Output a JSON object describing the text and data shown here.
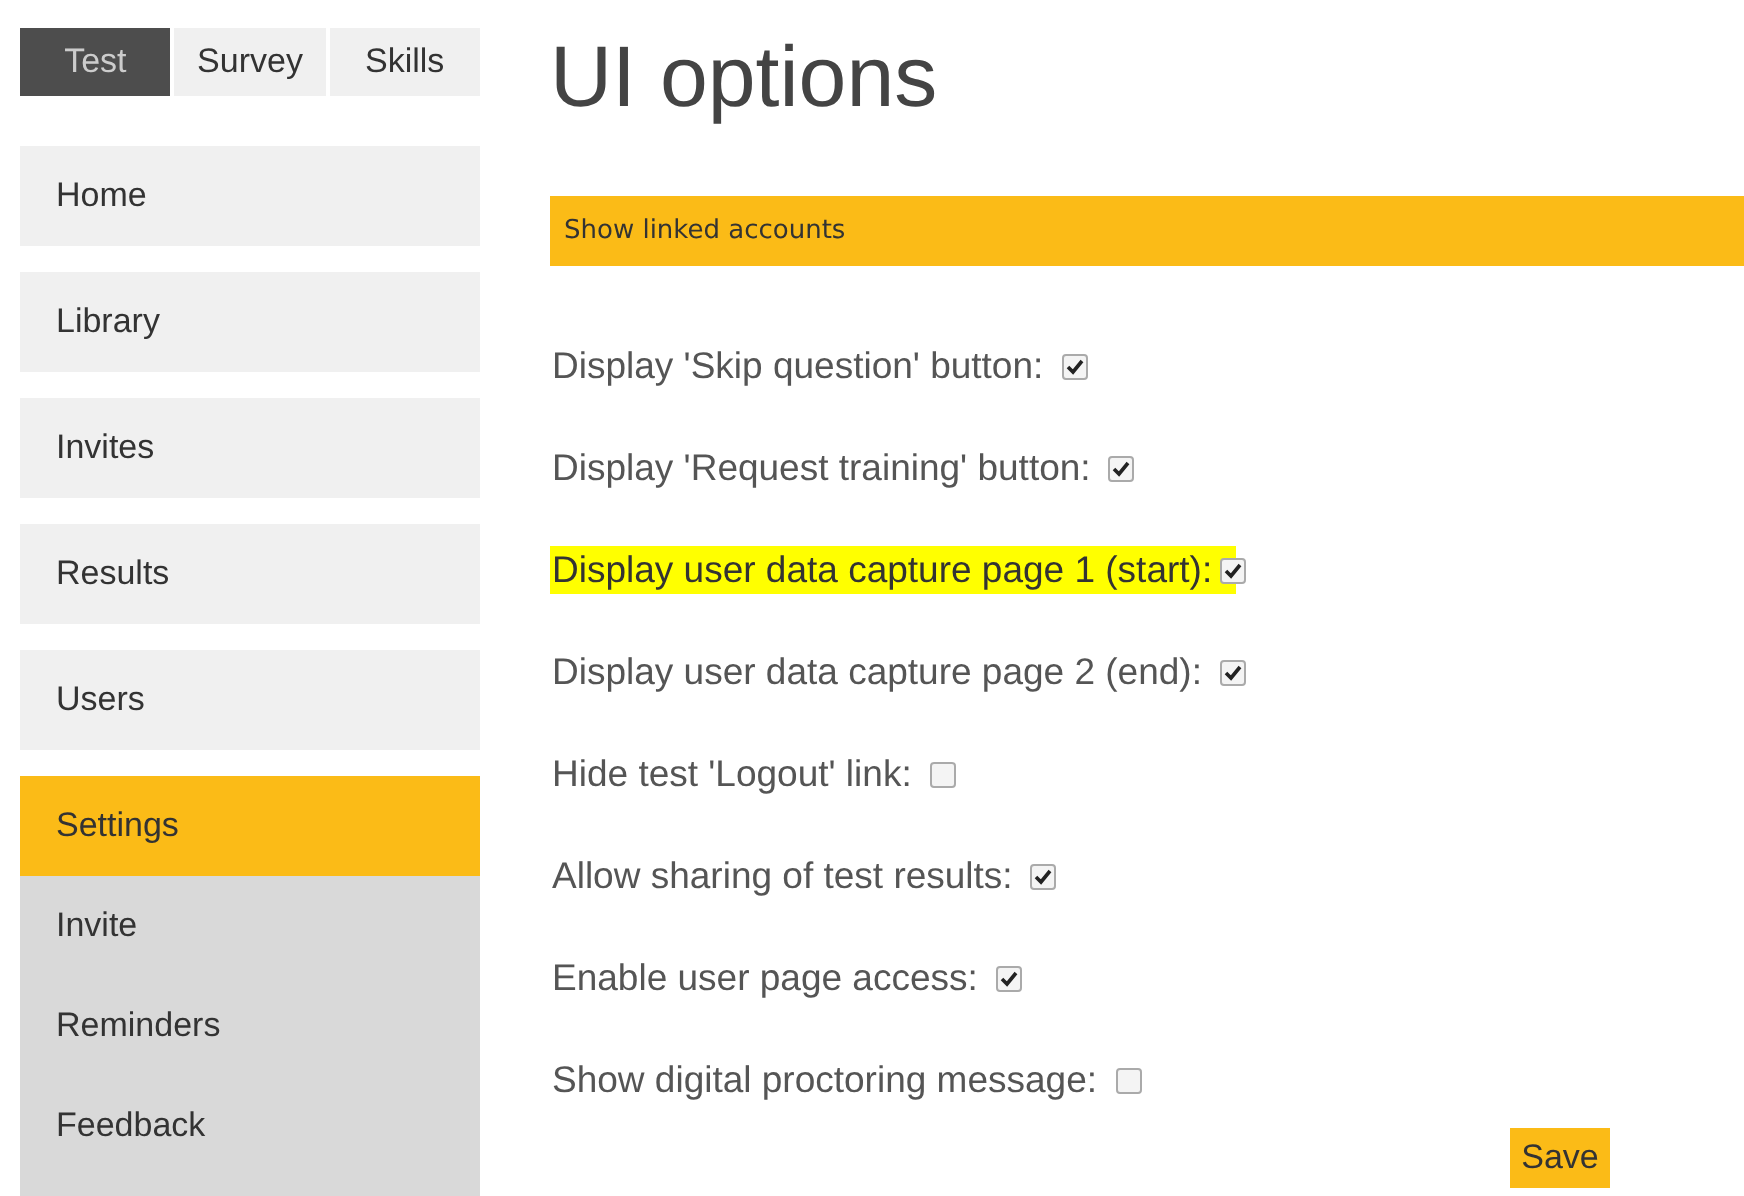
{
  "tabs": [
    {
      "label": "Test",
      "selected": true
    },
    {
      "label": "Survey",
      "selected": false
    },
    {
      "label": "Skills",
      "selected": false
    }
  ],
  "nav": [
    {
      "label": "Home",
      "selected": false
    },
    {
      "label": "Library",
      "selected": false
    },
    {
      "label": "Invites",
      "selected": false
    },
    {
      "label": "Results",
      "selected": false
    },
    {
      "label": "Users",
      "selected": false
    },
    {
      "label": "Settings",
      "selected": true,
      "children": [
        {
          "label": "Invite"
        },
        {
          "label": "Reminders"
        },
        {
          "label": "Feedback"
        }
      ]
    }
  ],
  "title": "UI options",
  "banner": "Show linked accounts",
  "options": [
    {
      "label": "Display 'Skip question' button:",
      "checked": true,
      "highlighted": false
    },
    {
      "label": "Display 'Request training' button:",
      "checked": true,
      "highlighted": false
    },
    {
      "label": "Display user data capture page 1 (start):",
      "checked": true,
      "highlighted": true
    },
    {
      "label": "Display user data capture page 2 (end):",
      "checked": true,
      "highlighted": false
    },
    {
      "label": "Hide test 'Logout' link:",
      "checked": false,
      "highlighted": false
    },
    {
      "label": "Allow sharing of test results:",
      "checked": true,
      "highlighted": false
    },
    {
      "label": "Enable user page access:",
      "checked": true,
      "highlighted": false
    },
    {
      "label": "Show digital proctoring message:",
      "checked": false,
      "highlighted": false
    }
  ],
  "save": "Save"
}
